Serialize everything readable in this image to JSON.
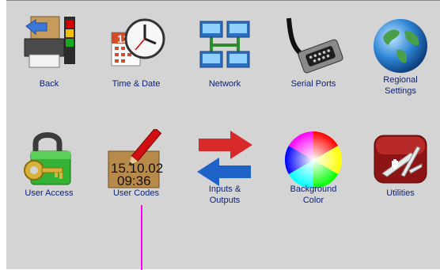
{
  "tiles": [
    {
      "id": "back",
      "label": "Back",
      "icon": "printer-back-icon"
    },
    {
      "id": "time-date",
      "label": "Time & Date",
      "icon": "calendar-clock-icon"
    },
    {
      "id": "network",
      "label": "Network",
      "icon": "network-icon"
    },
    {
      "id": "serial-ports",
      "label": "Serial Ports",
      "icon": "serial-cable-icon"
    },
    {
      "id": "regional-settings",
      "label": "Regional\nSettings",
      "icon": "globe-icon"
    },
    {
      "id": "user-access",
      "label": "User Access",
      "icon": "padlock-key-icon"
    },
    {
      "id": "user-codes",
      "label": "User Codes",
      "icon": "user-codes-icon"
    },
    {
      "id": "inputs-outputs",
      "label": "Inputs &\nOutputs",
      "icon": "arrows-icon"
    },
    {
      "id": "background-color",
      "label": "Background\nColor",
      "icon": "color-wheel-icon"
    },
    {
      "id": "utilities",
      "label": "Utilities",
      "icon": "swiss-knife-icon"
    }
  ],
  "user_codes_display": {
    "line1": "15.10.02",
    "line2": "09:36"
  },
  "calendar_day": "12",
  "colors": {
    "panel": "#d4d4d4",
    "label": "#0b1f78",
    "pointer": "#ff00ff"
  }
}
